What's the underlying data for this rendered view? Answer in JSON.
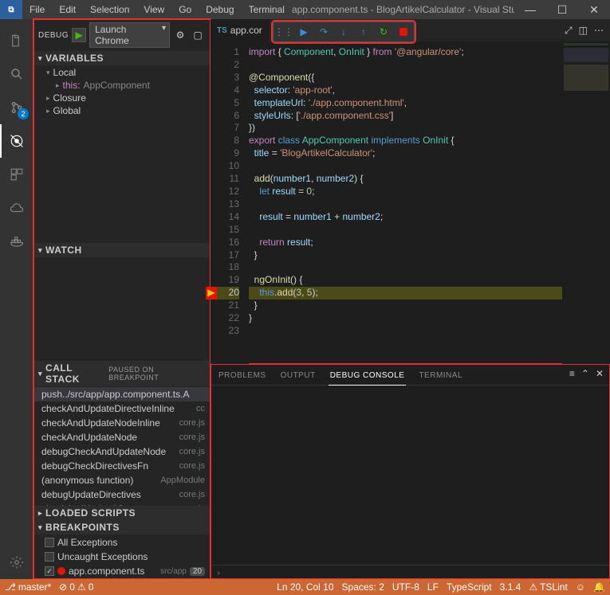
{
  "titlebar": {
    "menus": [
      "File",
      "Edit",
      "Selection",
      "View",
      "Go",
      "Debug",
      "Terminal"
    ],
    "title": "app.component.ts - BlogArtikelCalculator - Visual Studio C…"
  },
  "activity": {
    "scm_badge": "2"
  },
  "debug": {
    "label": "DEBUG",
    "config": "Launch Chrome",
    "sections": {
      "variables": "VARIABLES",
      "watch": "WATCH",
      "callstack": "CALL STACK",
      "callstack_status": "PAUSED ON BREAKPOINT",
      "loaded": "LOADED SCRIPTS",
      "breakpoints": "BREAKPOINTS"
    },
    "variables": {
      "local": "Local",
      "this": "this:",
      "this_type": "AppComponent",
      "closure": "Closure",
      "global": "Global"
    },
    "callstack": [
      {
        "fn": "push../src/app/app.component.ts.A",
        "src": ""
      },
      {
        "fn": "checkAndUpdateDirectiveInline",
        "src": "cc"
      },
      {
        "fn": "checkAndUpdateNodeInline",
        "src": "core.js"
      },
      {
        "fn": "checkAndUpdateNode",
        "src": "core.js"
      },
      {
        "fn": "debugCheckAndUpdateNode",
        "src": "core.js"
      },
      {
        "fn": "debugCheckDirectivesFn",
        "src": "core.js"
      },
      {
        "fn": "(anonymous function)",
        "src": "AppModule"
      },
      {
        "fn": "debugUpdateDirectives",
        "src": "core.js"
      },
      {
        "fn": "checkAndUpdateView",
        "src": "core.js"
      }
    ],
    "breakpoints": {
      "all_ex": "All Exceptions",
      "uncaught": "Uncaught Exceptions",
      "file": "app.component.ts",
      "file_src": "src/app",
      "file_line": "20"
    }
  },
  "tab": {
    "icon": "TS",
    "name": "app.cor"
  },
  "editor": {
    "line_count": 23,
    "current_line": 20
  },
  "panel": {
    "tabs": [
      "PROBLEMS",
      "OUTPUT",
      "DEBUG CONSOLE",
      "TERMINAL"
    ],
    "active": 2,
    "prompt": "›"
  },
  "status": {
    "branch": "master*",
    "errors": "0",
    "warnings": "0",
    "cursor": "Ln 20, Col 10",
    "spaces": "Spaces: 2",
    "encoding": "UTF-8",
    "eol": "LF",
    "lang": "TypeScript",
    "version": "3.1.4",
    "lint": "TSLint"
  }
}
